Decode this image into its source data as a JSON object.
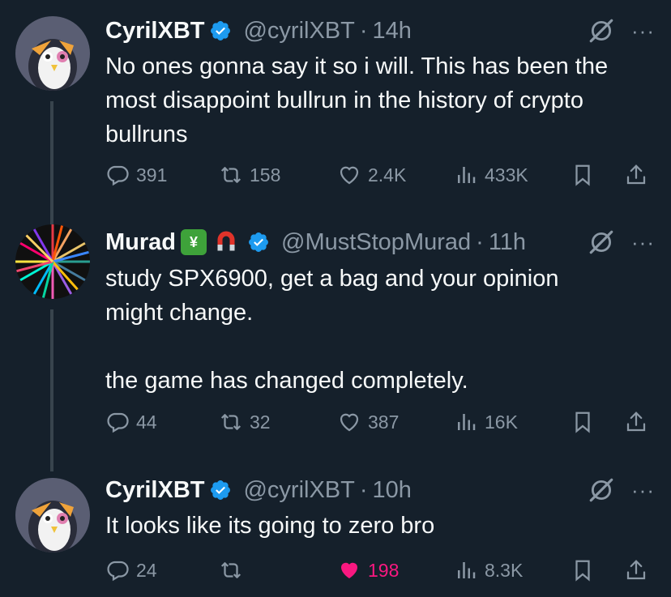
{
  "tweets": [
    {
      "name": "CyrilXBT",
      "handle": "@cyrilXBT",
      "dot": "·",
      "time": "14h",
      "avatar": "penguin-avatar",
      "verified": true,
      "text": "No ones gonna say it so i will. This has been the\nmost disappoint bullrun in the history of crypto\nbullruns",
      "replies": "391",
      "reposts": "158",
      "likes": "2.4K",
      "views": "433K",
      "liked": false
    },
    {
      "name": "Murad",
      "handle": "@MustStopMurad",
      "dot": "·",
      "time": "11h",
      "avatar": "rainbow-burst-avatar",
      "verified": true,
      "name_emojis": [
        "chart-yen-emoji",
        "magnet-emoji"
      ],
      "text": "study SPX6900, get a bag and your opinion\nmight change.\n\nthe game has changed completely.",
      "replies": "44",
      "reposts": "32",
      "likes": "387",
      "views": "16K",
      "liked": false
    },
    {
      "name": "CyrilXBT",
      "handle": "@cyrilXBT",
      "dot": "·",
      "time": "10h",
      "avatar": "penguin-avatar",
      "verified": true,
      "text": "It looks like its going to zero bro",
      "replies": "24",
      "reposts": "",
      "likes": "198",
      "views": "8.3K",
      "liked": true
    }
  ],
  "more_label": "···",
  "colors": {
    "background": "#15202b",
    "text": "#f7f9f9",
    "muted": "#8b98a5",
    "verified": "#1d9bf0",
    "like": "#f91880",
    "thread_line": "#38444d"
  }
}
